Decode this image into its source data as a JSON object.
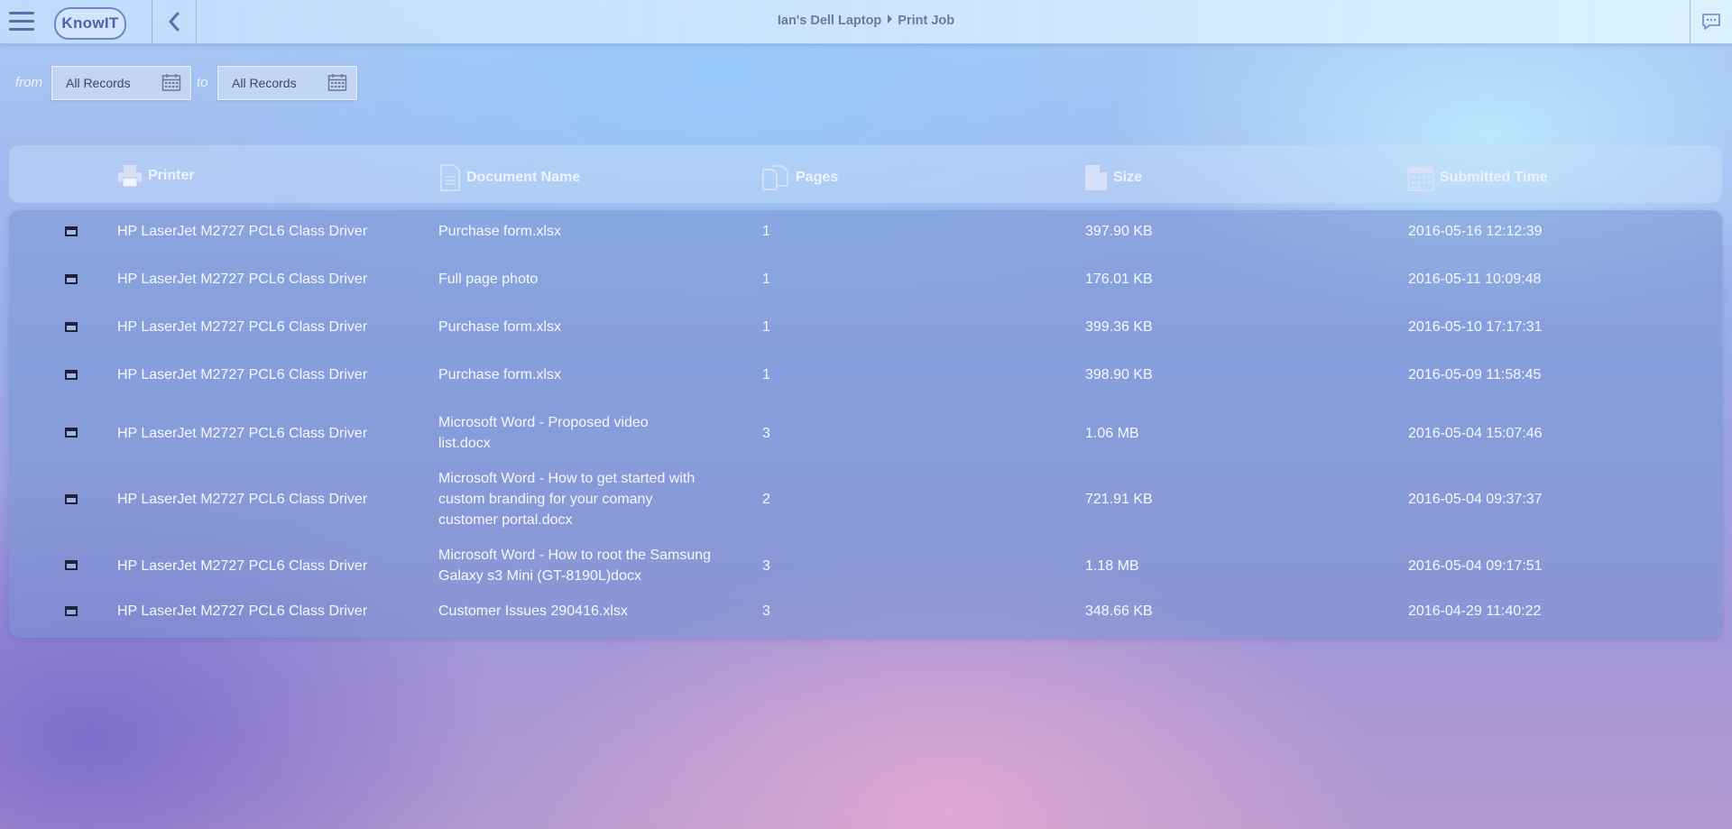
{
  "header": {
    "logo_text": "KnowIT",
    "breadcrumbs": [
      "Ian's Dell Laptop",
      "Print Job"
    ],
    "menu_icon": "hamburger-menu-icon",
    "back_icon": "chevron-left-icon",
    "chat_icon": "chat-bubble-icon"
  },
  "filters": {
    "from_label": "from",
    "from_value": "All Records",
    "to_label": "to",
    "to_value": "All Records"
  },
  "table": {
    "columns": [
      {
        "label": "Printer",
        "icon": "printer-icon"
      },
      {
        "label": "Document Name",
        "icon": "document-icon"
      },
      {
        "label": "Pages",
        "icon": "pages-icon"
      },
      {
        "label": "Size",
        "icon": "file-icon"
      },
      {
        "label": "Submitted Time",
        "icon": "calendar-icon"
      }
    ],
    "rows": [
      {
        "printer": "HP LaserJet M2727 PCL6 Class Driver",
        "document": [
          "Purchase form.xlsx"
        ],
        "pages": "1",
        "size": "397.90 KB",
        "time": "2016-05-16 12:12:39"
      },
      {
        "printer": "HP LaserJet M2727 PCL6 Class Driver",
        "document": [
          "Full page photo"
        ],
        "pages": "1",
        "size": "176.01 KB",
        "time": "2016-05-11 10:09:48"
      },
      {
        "printer": "HP LaserJet M2727 PCL6 Class Driver",
        "document": [
          "Purchase form.xlsx"
        ],
        "pages": "1",
        "size": "399.36 KB",
        "time": "2016-05-10 17:17:31"
      },
      {
        "printer": "HP LaserJet M2727 PCL6 Class Driver",
        "document": [
          "Purchase form.xlsx"
        ],
        "pages": "1",
        "size": "398.90 KB",
        "time": "2016-05-09 11:58:45"
      },
      {
        "printer": "HP LaserJet M2727 PCL6 Class Driver",
        "document": [
          "Microsoft Word - Proposed video",
          "list.docx"
        ],
        "pages": "3",
        "size": "1.06 MB",
        "time": "2016-05-04 15:07:46"
      },
      {
        "printer": "HP LaserJet M2727 PCL6 Class Driver",
        "document": [
          "Microsoft Word - How to get started with",
          "custom branding for your comany",
          "customer portal.docx"
        ],
        "pages": "2",
        "size": "721.91 KB",
        "time": "2016-05-04 09:37:37"
      },
      {
        "printer": "HP LaserJet M2727 PCL6 Class Driver",
        "document": [
          "Microsoft Word - How to root the Samsung",
          "Galaxy s3 Mini (GT-8190L)docx"
        ],
        "pages": "3",
        "size": "1.18 MB",
        "time": "2016-05-04 09:17:51"
      },
      {
        "printer": "HP LaserJet M2727 PCL6 Class Driver",
        "document": [
          "Customer Issues 290416.xlsx"
        ],
        "pages": "3",
        "size": "348.66 KB",
        "time": "2016-04-29 11:40:22"
      }
    ]
  }
}
